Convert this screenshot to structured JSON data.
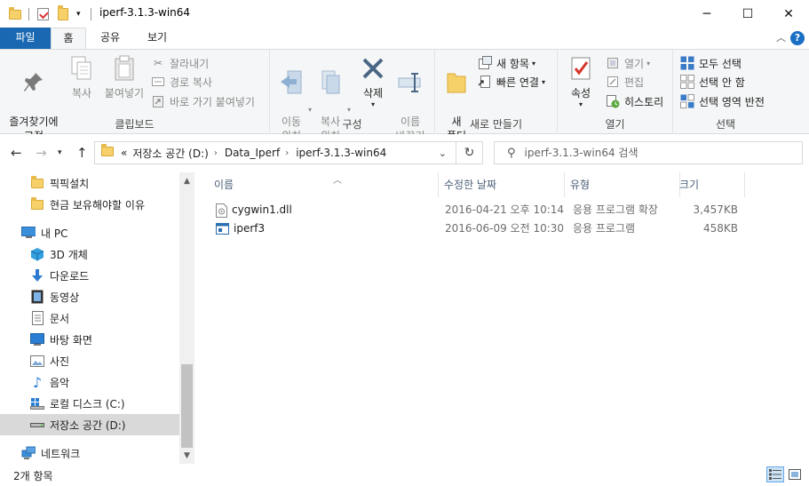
{
  "window": {
    "title": "iperf-3.1.3-win64",
    "minimize": "─",
    "maximize": "☐",
    "close": "✕"
  },
  "ribbon_tabs": [
    "파일",
    "홈",
    "공유",
    "보기"
  ],
  "help": "?",
  "ribbon": {
    "clipboard": {
      "label": "클립보드",
      "pin": "즐겨찾기에\n고정",
      "copy": "복사",
      "paste": "붙여넣기",
      "cut": "잘라내기",
      "copy_path": "경로 복사",
      "paste_shortcut": "바로 가기 붙여넣기"
    },
    "organize": {
      "label": "구성",
      "move_to": "이동\n위치",
      "copy_to": "복사\n위치",
      "delete": "삭제",
      "rename": "이름\n바꾸기"
    },
    "new": {
      "label": "새로 만들기",
      "new_folder": "새\n폴더",
      "new_item": "새 항목",
      "easy_access": "빠른 연결"
    },
    "open": {
      "label": "열기",
      "properties": "속성",
      "open": "열기",
      "edit": "편집",
      "history": "히스토리"
    },
    "select": {
      "label": "선택",
      "select_all": "모두 선택",
      "select_none": "선택 안 함",
      "invert": "선택 영역 반전"
    }
  },
  "address": {
    "prefix": "«",
    "crumbs": [
      "저장소 공간 (D:)",
      "Data_Iperf",
      "iperf-3.1.3-win64"
    ],
    "search_placeholder": "iperf-3.1.3-win64 검색"
  },
  "nav_pane": {
    "items": [
      {
        "label": "픽픽설치",
        "icon": "folder"
      },
      {
        "label": "현금 보유해야할 이유",
        "icon": "folder"
      },
      {
        "label": "내 PC",
        "icon": "pc"
      },
      {
        "label": "3D 개체",
        "icon": "cube"
      },
      {
        "label": "다운로드",
        "icon": "download"
      },
      {
        "label": "동영상",
        "icon": "video"
      },
      {
        "label": "문서",
        "icon": "document"
      },
      {
        "label": "바탕 화면",
        "icon": "desktop"
      },
      {
        "label": "사진",
        "icon": "picture"
      },
      {
        "label": "음악",
        "icon": "music"
      },
      {
        "label": "로컬 디스크 (C:)",
        "icon": "disk-c"
      },
      {
        "label": "저장소 공간 (D:)",
        "icon": "disk-d"
      },
      {
        "label": "네트워크",
        "icon": "network"
      }
    ]
  },
  "file_list": {
    "columns": [
      "이름",
      "수정한 날짜",
      "유형",
      "크기"
    ],
    "files": [
      {
        "name": "cygwin1.dll",
        "modified": "2016-04-21 오후 10:14",
        "type": "응용 프로그램 확장",
        "size": "3,457KB",
        "icon": "dll"
      },
      {
        "name": "iperf3",
        "modified": "2016-06-09 오전 10:30",
        "type": "응용 프로그램",
        "size": "458KB",
        "icon": "exe"
      }
    ]
  },
  "status": {
    "count": "2개 항목"
  },
  "colors": {
    "file_tab": "#1a68b2",
    "selection": "#d9d9d9",
    "header_text": "#4c607a"
  }
}
